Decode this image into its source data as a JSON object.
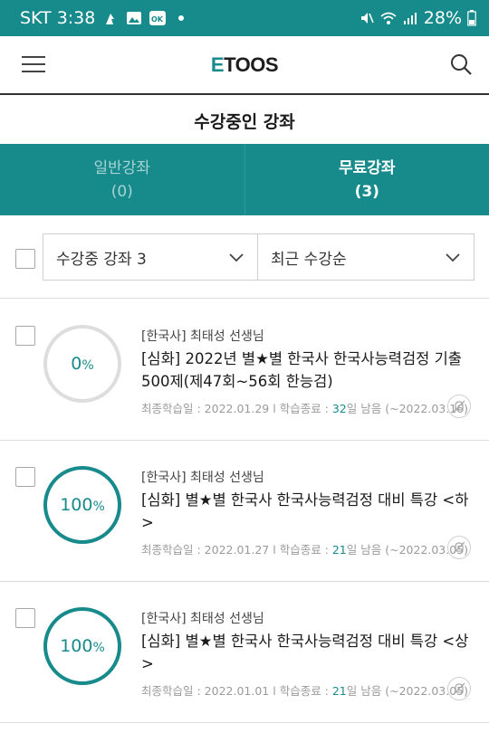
{
  "status_bar": {
    "carrier_time": "SKT 3:38",
    "battery": "28%",
    "icons": [
      "lock-person-icon",
      "image-icon",
      "ok-app-icon",
      "dot-icon",
      "mute-icon",
      "wifi-icon",
      "signal-icon",
      "battery-icon"
    ]
  },
  "header": {
    "logo_e": "E",
    "logo_rest": "TOOS",
    "menu_icon": "hamburger-menu-icon",
    "search_icon": "search-icon"
  },
  "page": {
    "title": "수강중인 강좌"
  },
  "tabs": [
    {
      "label": "일반강좌",
      "count": "(0)",
      "active": false
    },
    {
      "label": "무료강좌",
      "count": "(3)",
      "active": true
    }
  ],
  "filters": {
    "course_filter": "수강중 강좌 3",
    "sort": "최근 수강순"
  },
  "colors": {
    "accent": "#178a8c",
    "ring_empty": "#dddddd"
  },
  "courses": [
    {
      "progress_value": "0",
      "progress_unit": "%",
      "progress_fraction": 0,
      "meta": "[한국사] 최태성 선생님",
      "title": "[심화] 2022년 별★별 한국사 한국사능력검정 기출 500제(제47회~56회 한능검)",
      "last_study_label": "최종학습일 : 2022.01.29",
      "sep": "l",
      "end_label": "학습종료 : ",
      "days_left": "32",
      "days_suffix": "일 남음 (~2022.03.16)"
    },
    {
      "progress_value": "100",
      "progress_unit": "%",
      "progress_fraction": 1,
      "meta": "[한국사] 최태성 선생님",
      "title": "[심화] 별★별 한국사 한국사능력검정 대비 특강 <하>",
      "last_study_label": "최종학습일 : 2022.01.27",
      "sep": "l",
      "end_label": "학습종료 : ",
      "days_left": "21",
      "days_suffix": "일 남음 (~2022.03.05)"
    },
    {
      "progress_value": "100",
      "progress_unit": "%",
      "progress_fraction": 1,
      "meta": "[한국사] 최태성 선생님",
      "title": "[심화] 별★별 한국사 한국사능력검정 대비 특강 <상>",
      "last_study_label": "최종학습일 : 2022.01.01",
      "sep": "l",
      "end_label": "학습종료 : ",
      "days_left": "21",
      "days_suffix": "일 남음 (~2022.03.05)"
    }
  ]
}
